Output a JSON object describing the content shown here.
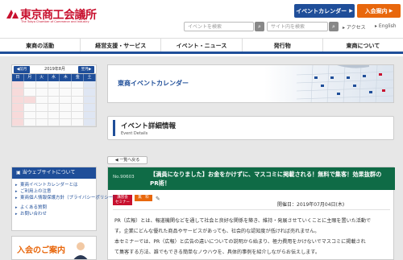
{
  "header": {
    "logo_main": "東京商工会議所",
    "logo_sub": "The Tokyo Chamber of Commerce and Industry",
    "event_calendar_btn": "イベントカレンダー",
    "join_btn": "入会案内",
    "event_search_placeholder": "イベントを検索",
    "site_search_placeholder": "サイト内を検索",
    "search_icon": "search-icon",
    "access_link": "アクセス",
    "english_link": "English",
    "brand_color": "#c8102e",
    "accent_blue": "#1f4e99",
    "accent_orange": "#e8670c"
  },
  "nav": [
    {
      "label": "東商の活動"
    },
    {
      "label": "経営支援・サービス"
    },
    {
      "label": "イベント・ニュース"
    },
    {
      "label": "発行物"
    },
    {
      "label": "東商について"
    }
  ],
  "calendar": {
    "prev_label": "前月",
    "next_label": "翌月",
    "title": "2019年8月",
    "weekdays": [
      "日",
      "月",
      "火",
      "水",
      "木",
      "金",
      "土"
    ]
  },
  "banner": {
    "title": "東商イベントカレンダー"
  },
  "page_title": {
    "main": "イベント詳細情報",
    "sub": "Event Details"
  },
  "back_button": "一覧へ戻る",
  "event": {
    "number": "No.90603",
    "title": "【満員になりました】お金をかけずに、マスコミに掲載される！無料で集客！効果抜群のPR術！",
    "tag_seminar": "講習会\nセミナー",
    "tag_free": "無　料",
    "bookmark_icon": "bookmark-icon",
    "held_date": "開催日：2019年07月04日(木)",
    "body": [
      "PR（広報）とは、報道機関などを通して社会と良好な関係を築き、維持・発展させていくことに主眼を置いた活動で",
      "す。企業にどんな優れた商品やサービスがあっても、社会的な認知度が低ければ売れません。",
      "本セミナーでは、PR（広報）と広告の違いについての説明から始まり、極力費用をかけないでマスコミに掲載され",
      "て集客する方法、誰でもできる簡単なノウハウを、具体的事例を紹介しながらお伝えします。"
    ],
    "header_color": "#0f6b46"
  },
  "sidebar": {
    "heading": "当ウェブサイトについて",
    "links_a": [
      "東商イベントカレンダーとは",
      "ご利用上の注意",
      "東商個人情報保護方針（プライバシーポリシー）"
    ],
    "links_b": [
      "よくある質問",
      "お問い合わせ"
    ],
    "join_banner": "入会のご案内"
  }
}
